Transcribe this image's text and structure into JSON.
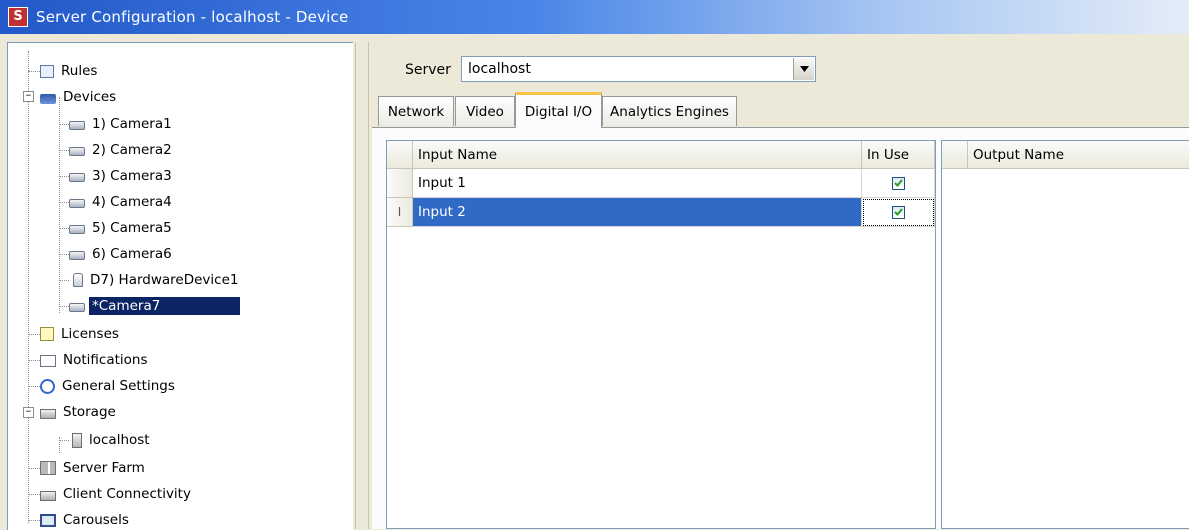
{
  "window": {
    "title": "Server Configuration - localhost - Device",
    "app_icon": "S"
  },
  "tree": {
    "items": [
      {
        "label": "Rules",
        "icon": "rules-icon"
      },
      {
        "label": "Devices",
        "icon": "devices-icon",
        "expanded": true
      },
      {
        "label": "1) Camera1",
        "icon": "camera-icon"
      },
      {
        "label": "2) Camera2",
        "icon": "camera-icon"
      },
      {
        "label": "3) Camera3",
        "icon": "camera-icon"
      },
      {
        "label": "4) Camera4",
        "icon": "camera-icon"
      },
      {
        "label": "5) Camera5",
        "icon": "camera-icon"
      },
      {
        "label": "6) Camera6",
        "icon": "camera-icon"
      },
      {
        "label": "D7) HardwareDevice1",
        "icon": "hardware-device-icon"
      },
      {
        "label": "*Camera7",
        "icon": "camera-icon",
        "selected": true
      },
      {
        "label": "Licenses",
        "icon": "licenses-icon"
      },
      {
        "label": "Notifications",
        "icon": "notifications-icon"
      },
      {
        "label": "General Settings",
        "icon": "general-settings-icon"
      },
      {
        "label": "Storage",
        "icon": "storage-icon",
        "expanded": true
      },
      {
        "label": "localhost",
        "icon": "server-icon"
      },
      {
        "label": "Server Farm",
        "icon": "server-farm-icon"
      },
      {
        "label": "Client Connectivity",
        "icon": "client-connectivity-icon"
      },
      {
        "label": "Carousels",
        "icon": "carousels-icon"
      }
    ]
  },
  "server": {
    "label": "Server",
    "value": "localhost"
  },
  "tabs": [
    {
      "label": "Network"
    },
    {
      "label": "Video"
    },
    {
      "label": "Digital I/O",
      "active": true
    },
    {
      "label": "Analytics Engines"
    }
  ],
  "inputs_table": {
    "headers": {
      "name": "Input Name",
      "in_use": "In Use"
    },
    "rows": [
      {
        "name": "Input 1",
        "in_use": true
      },
      {
        "name": "Input 2",
        "in_use": true,
        "selected": true,
        "row_marker": "I"
      }
    ]
  },
  "outputs_table": {
    "headers": {
      "name": "Output Name"
    },
    "rows": []
  },
  "colors": {
    "selection": "#3169c6",
    "tree_selection": "#0b2463",
    "active_tab_accent": "#fbc34a"
  }
}
